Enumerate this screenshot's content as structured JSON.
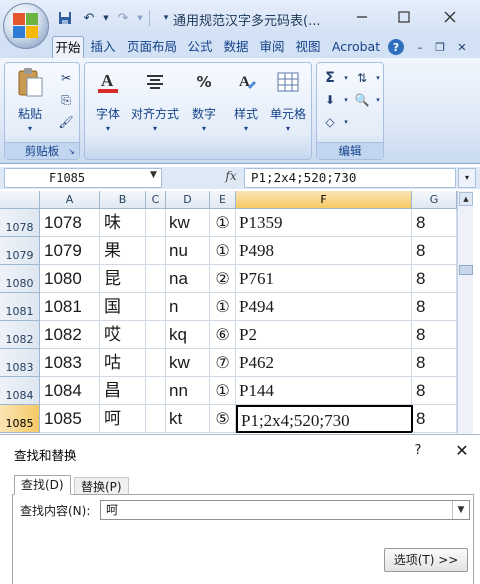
{
  "title_bar": {
    "document_title": "通用规范汉字多元码表(...",
    "minimize_icon": "minimize-icon",
    "maximize_icon": "maximize-icon",
    "close_icon": "close-icon"
  },
  "quick_access": {
    "save_icon": "save-icon",
    "undo_icon": "undo-icon",
    "redo_icon": "redo-icon",
    "customize_icon": "chevron-down-icon"
  },
  "ribbon_tabs": [
    {
      "label": "开始",
      "active": true
    },
    {
      "label": "插入",
      "active": false
    },
    {
      "label": "页面布局",
      "active": false
    },
    {
      "label": "公式",
      "active": false
    },
    {
      "label": "数据",
      "active": false
    },
    {
      "label": "审阅",
      "active": false
    },
    {
      "label": "视图",
      "active": false
    },
    {
      "label": "Acrobat",
      "active": false
    }
  ],
  "ribbon": {
    "clipboard_group": "剪贴板",
    "paste": "粘贴",
    "font": "字体",
    "alignment": "对齐方式",
    "number": "数字",
    "styles": "样式",
    "cells": "单元格",
    "editing_group": "编辑",
    "number_symbol": "%"
  },
  "formula_bar": {
    "name_box": "F1085",
    "fx": "fx",
    "formula": "P1;2x4;520;730"
  },
  "columns": [
    "A",
    "B",
    "C",
    "D",
    "E",
    "F",
    "G"
  ],
  "selected_column": "F",
  "rows": [
    {
      "row": "1078",
      "a": "1078",
      "b": "味",
      "d": "kw",
      "e": "①",
      "f": "P1359",
      "g": "8"
    },
    {
      "row": "1079",
      "a": "1079",
      "b": "果",
      "d": "nu",
      "e": "①",
      "f": "P498",
      "g": "8"
    },
    {
      "row": "1080",
      "a": "1080",
      "b": "昆",
      "d": "na",
      "e": "②",
      "f": "P761",
      "g": "8"
    },
    {
      "row": "1081",
      "a": "1081",
      "b": "国",
      "d": "n",
      "e": "①",
      "f": "P494",
      "g": "8"
    },
    {
      "row": "1082",
      "a": "1082",
      "b": "哎",
      "d": "kq",
      "e": "⑥",
      "f": "P2",
      "g": "8"
    },
    {
      "row": "1083",
      "a": "1083",
      "b": "咕",
      "d": "kw",
      "e": "⑦",
      "f": "P462",
      "g": "8"
    },
    {
      "row": "1084",
      "a": "1084",
      "b": "昌",
      "d": "nn",
      "e": "①",
      "f": "P144",
      "g": "8"
    },
    {
      "row": "1085",
      "a": "1085",
      "b": "呵",
      "d": "kt",
      "e": "⑤",
      "f": "P1;2x4;520;730",
      "g": "8"
    }
  ],
  "selected_row": "1085",
  "dialog": {
    "title": "查找和替换",
    "help": "?",
    "close": "✕",
    "tab_find": "查找(D)",
    "tab_replace": "替换(P)",
    "find_label": "查找内容(N):",
    "find_value": "呵",
    "options_button": "选项(T) >>"
  }
}
